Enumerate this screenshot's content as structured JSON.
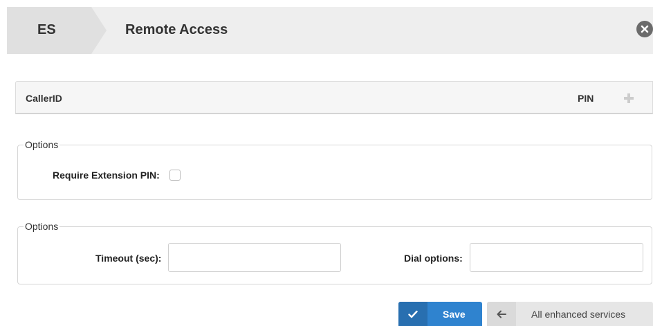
{
  "header": {
    "breadcrumb": "ES",
    "title": "Remote Access",
    "close_icon": "close-circle-icon"
  },
  "table": {
    "columns": [
      "CallerID",
      "PIN"
    ],
    "add_icon": "plus-icon",
    "rows": []
  },
  "options_general": {
    "legend": "Options",
    "require_pin_label": "Require Extension PIN:",
    "require_pin_checked": false
  },
  "options_dial": {
    "legend": "Options",
    "timeout_label": "Timeout (sec):",
    "timeout_value": "",
    "dial_options_label": "Dial options:",
    "dial_options_value": ""
  },
  "buttons": {
    "save_label": "Save",
    "save_icon": "check-icon",
    "back_label": "All enhanced services",
    "back_icon": "arrow-left-icon"
  },
  "colors": {
    "primary": "#2f83cf",
    "header_bg": "#eeeeee"
  }
}
